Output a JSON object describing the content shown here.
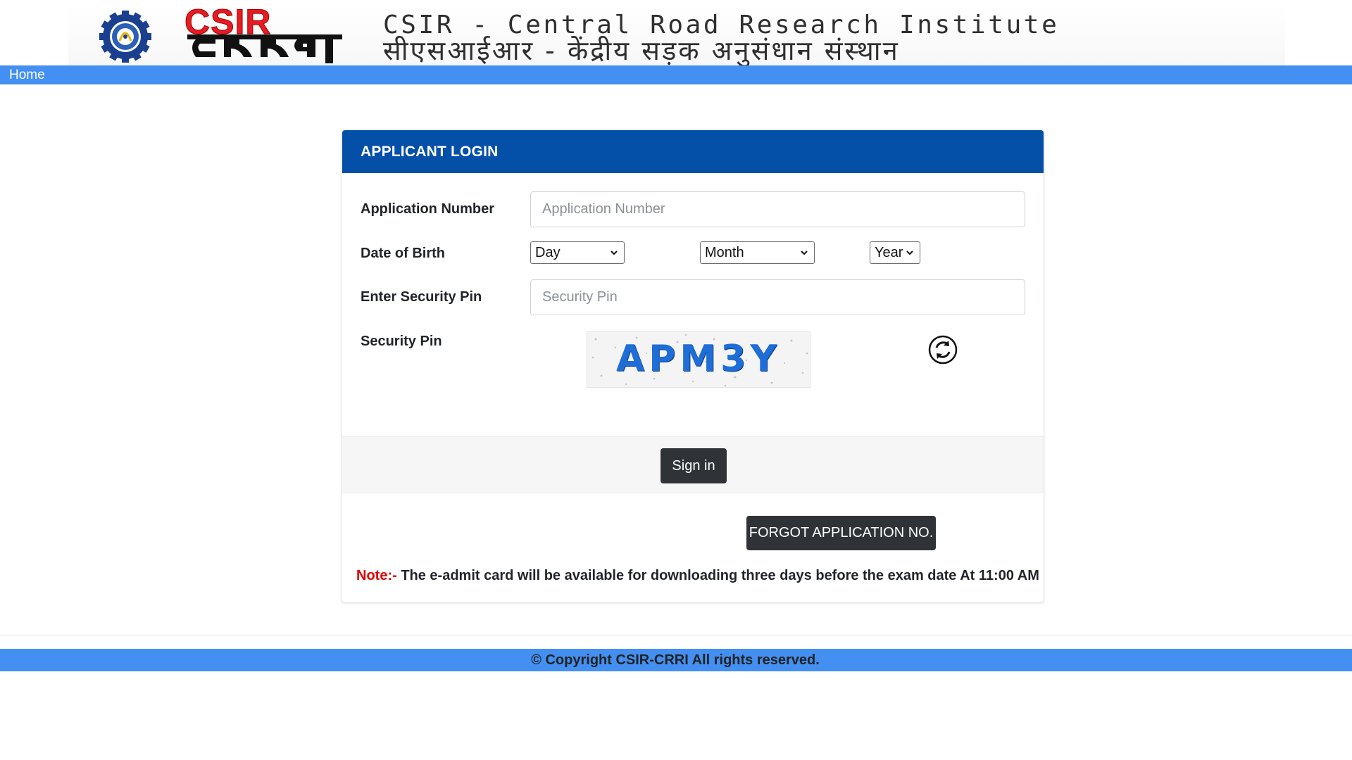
{
  "banner": {
    "logo_text_top": "CSIR",
    "logo_text_bottom": "CRRI",
    "title_en": "CSIR - Central Road Research Institute",
    "title_hi": "सीएसआईआर - केंद्रीय सड़क अनुसंधान संस्थान"
  },
  "nav": {
    "home_label": "Home"
  },
  "login": {
    "header_title": "APPLICANT LOGIN",
    "application_number_label": "Application Number",
    "application_number_placeholder": "Application Number",
    "application_number_value": "",
    "dob_label": "Date of Birth",
    "day_selected": "Day",
    "month_selected": "Month",
    "year_selected": "Year",
    "enter_pin_label": "Enter Security Pin",
    "pin_placeholder": "Security Pin",
    "pin_value": "",
    "captcha_label": "Security Pin",
    "captcha_text": "APM3Y",
    "signin_label": "Sign in",
    "forgot_label": "FORGOT APPLICATION NO.",
    "note_prefix": "Note:-",
    "note_text": " The e-admit card will be available for downloading three days before the exam date At 11:00 AM"
  },
  "footer": {
    "copyright": "© Copyright CSIR-CRRI All rights reserved."
  },
  "colors": {
    "nav_blue": "#4390f2",
    "header_blue": "#0450a8",
    "button_dark": "#2f3337",
    "note_red": "#e00000",
    "logo_red": "#e51c23"
  },
  "icons": {
    "logo": "csir-gear-logo-icon",
    "refresh": "refresh-captcha-icon",
    "dropdown": "chevron-down-icon"
  }
}
